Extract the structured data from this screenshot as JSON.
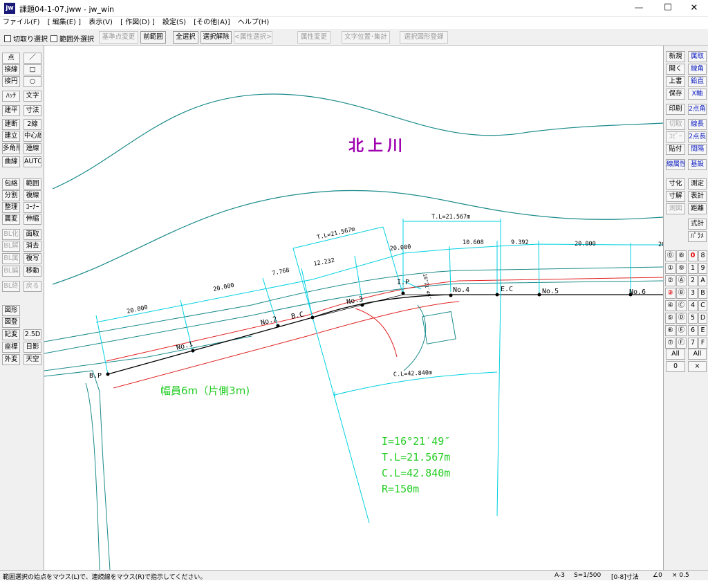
{
  "window": {
    "title": "課題04-1-07.jww - jw_win",
    "app_icon": "jw",
    "controls": {
      "minimize": "—",
      "maximize": "☐",
      "close": "✕"
    }
  },
  "menu": [
    "ファイル(F)",
    "[ 編集(E) ]",
    "表示(V)",
    "[ 作図(D) ]",
    "設定(S)",
    "[その他(A)]",
    "ヘルプ(H)"
  ],
  "toolbar": {
    "check1": "切取り選択",
    "check2": "範囲外選択",
    "buttons": [
      "基準点変更",
      "前範囲",
      "全選択",
      "選択解除",
      "<属性選択>",
      "属性変更",
      "文字位置･集計",
      "選択図形登録"
    ]
  },
  "left_tools": {
    "col1": [
      "点",
      "接線",
      "接円",
      "ﾊｯﾁ",
      "建平",
      "建断",
      "建立",
      "多角形",
      "曲線",
      "包絡",
      "分割",
      "整理",
      "属変",
      "BL化",
      "BL解",
      "BL属",
      "BL編",
      "BL終",
      "図形",
      "図登",
      "記変",
      "座標",
      "外変"
    ],
    "col2": [
      "／",
      "□",
      "○",
      "文字",
      "寸法",
      "2線",
      "中心線",
      "連線",
      "AUTO",
      "範囲",
      "複線",
      "ｺｰﾅｰ",
      "伸縮",
      "面取",
      "消去",
      "複写",
      "移動",
      "戻る",
      "",
      "",
      "2.5D",
      "日影",
      "天空"
    ]
  },
  "right_tools": {
    "col1": [
      "新規",
      "開く",
      "上書",
      "保存",
      "印刷",
      "切取",
      "ｺﾋﾟｰ",
      "貼付",
      "線属性",
      "寸化",
      "寸解",
      "測図",
      "",
      "",
      "",
      "",
      "",
      "",
      "",
      "",
      "",
      "All",
      "0"
    ],
    "col2": [
      "属取",
      "線角",
      "鉛直",
      "X軸",
      "2点角",
      "線長",
      "2点長",
      "間隔",
      "基設",
      "測定",
      "表計",
      "距離",
      "式計",
      "ﾊﾟﾗﾒ",
      "",
      "",
      "",
      "",
      "",
      "",
      "",
      "All",
      "×"
    ],
    "layer_groups": [
      "0",
      "1",
      "2",
      "3",
      "4",
      "5",
      "6",
      "7"
    ],
    "layer_circles": [
      "⓪",
      "⑧",
      "①",
      "⑨",
      "②",
      "Ⓐ",
      "③",
      "Ⓑ",
      "④",
      "Ⓒ",
      "⑤",
      "Ⓓ",
      "⑥",
      "Ⓔ",
      "⑦",
      "Ⓕ"
    ],
    "layers": [
      "0",
      "8",
      "1",
      "9",
      "2",
      "A",
      "3",
      "B",
      "4",
      "C",
      "5",
      "D",
      "6",
      "E",
      "7",
      "F"
    ]
  },
  "drawing": {
    "river_name": "北上川",
    "width_note": "幅員6m（片側3m)",
    "stations": [
      "B.P",
      "No.1",
      "No.2",
      "B.C",
      "No.3",
      "I.P",
      "No.4",
      "E.C",
      "No.5",
      "No.6"
    ],
    "dims": [
      "20.000",
      "20.000",
      "7.768",
      "12.232",
      "20.000",
      "10.608",
      "9.392",
      "20.000",
      "20"
    ],
    "tl1": "T.L=21.567m",
    "tl2": "T.L=21.567m",
    "cl": "C.L=42.840m",
    "angle_small": "16°21′49″",
    "curve": {
      "I": "I=16°21′49″",
      "TL": "T.L=21.567m",
      "CL": "C.L=42.840m",
      "R": "R=150m"
    }
  },
  "status": {
    "message": "範囲選択の始点をマウス(L)で、連続線をマウス(R)で指示してください。",
    "paper": "A-3",
    "scale": "S=1/500",
    "layer": "[0-8]寸法",
    "angle": "∠0",
    "factor": "× 0.5"
  }
}
